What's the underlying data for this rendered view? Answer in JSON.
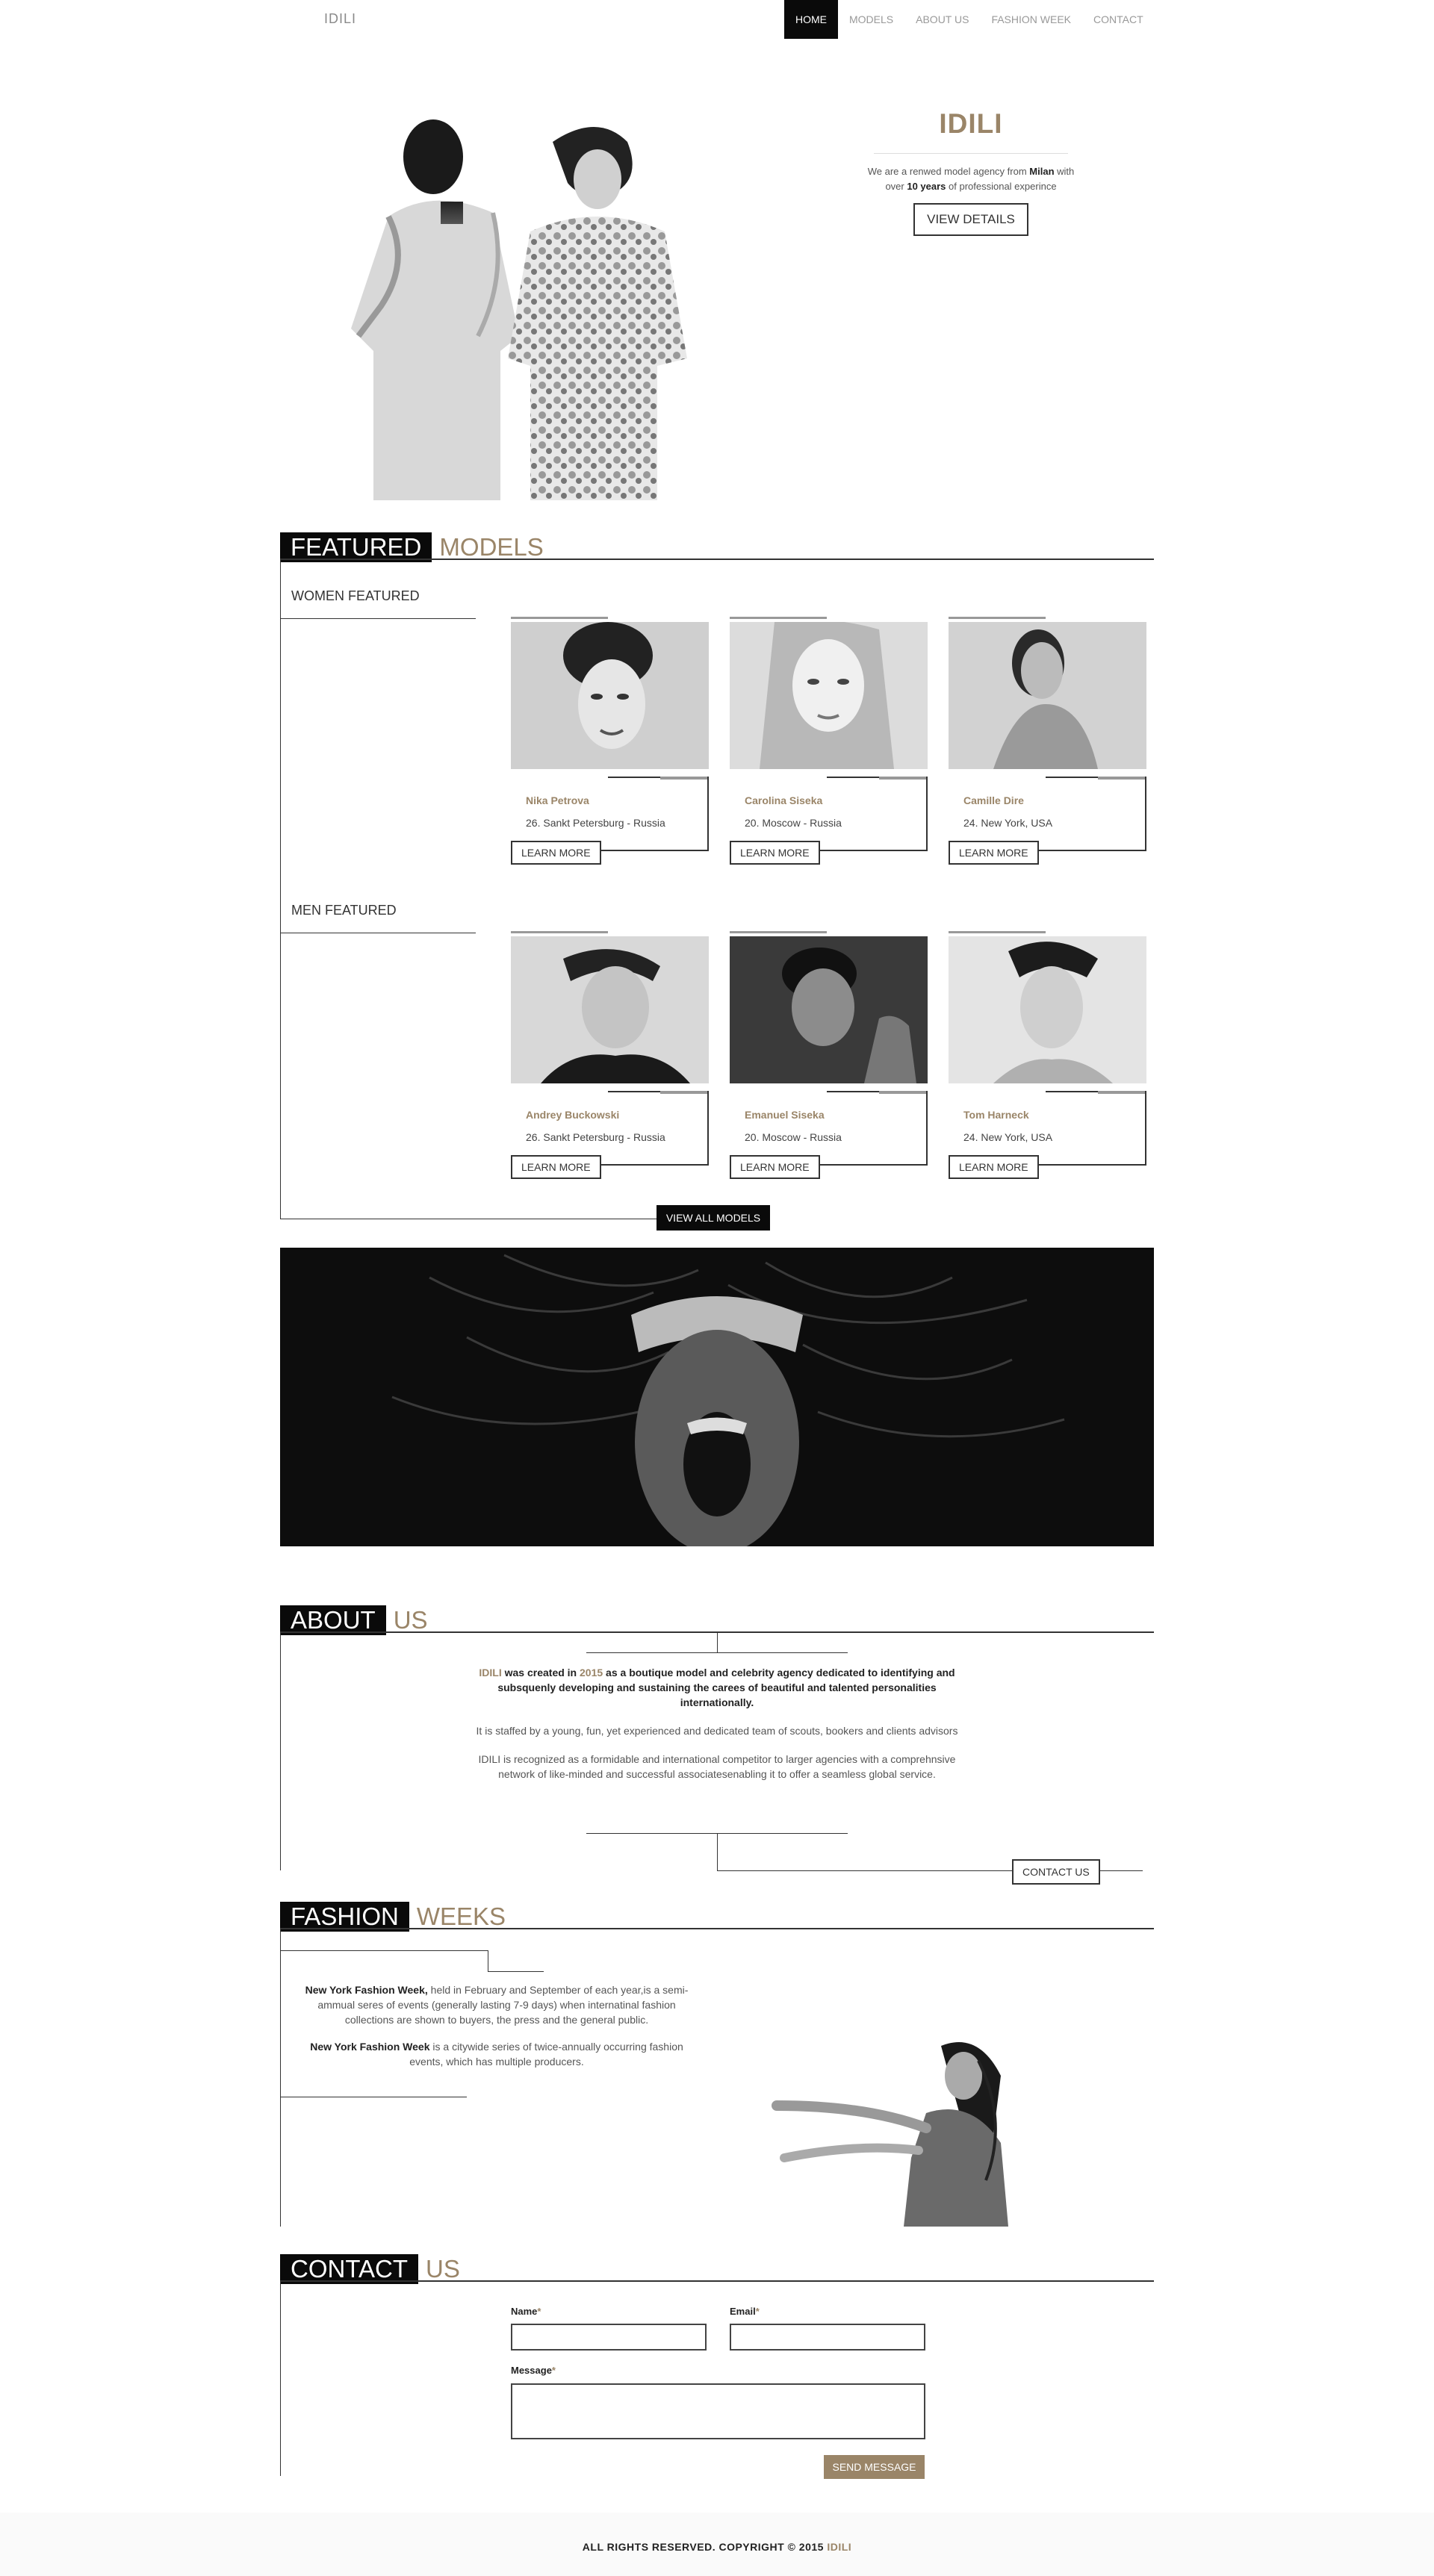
{
  "nav": {
    "brand": "IDILI",
    "items": [
      {
        "label": "HOME",
        "active": true
      },
      {
        "label": "MODELS",
        "active": false
      },
      {
        "label": "ABOUT US",
        "active": false
      },
      {
        "label": "FASHION WEEK",
        "active": false
      },
      {
        "label": "CONTACT",
        "active": false
      }
    ]
  },
  "hero": {
    "title": "IDILI",
    "desc_pre": "We are a renwed model agency from ",
    "desc_city": "Milan",
    "desc_mid": " with over ",
    "desc_years": "10 years",
    "desc_post": " of professional experince",
    "button": "VIEW DETAILS"
  },
  "featured": {
    "head_bold": "FEATURED",
    "head_light": "MODELS",
    "women_title": "WOMEN FEATURED",
    "men_title": "MEN FEATURED",
    "women": [
      {
        "name": "Nika Petrova",
        "location": "26. Sankt Petersburg - Russia",
        "button": "LEARN MORE"
      },
      {
        "name": "Carolina Siseka",
        "location": "20. Moscow - Russia",
        "button": "LEARN MORE"
      },
      {
        "name": "Camille Dire",
        "location": "24. New York, USA",
        "button": "LEARN MORE"
      }
    ],
    "men": [
      {
        "name": "Andrey Buckowski",
        "location": "26. Sankt Petersburg - Russia",
        "button": "LEARN MORE"
      },
      {
        "name": "Emanuel Siseka",
        "location": "20. Moscow - Russia",
        "button": "LEARN MORE"
      },
      {
        "name": "Tom Harneck",
        "location": "24. New York, USA",
        "button": "LEARN MORE"
      }
    ],
    "view_all": "VIEW ALL MODELS"
  },
  "about": {
    "head_bold": "ABOUT",
    "head_light": "US",
    "p1_brand": "IDILI",
    "p1_a": " was created in ",
    "p1_year": "2015",
    "p1_b": " as a boutique model and celebrity agency dedicated to identifying and subsquenly developing and sustaining the carees of beautiful and talented personalities internationally.",
    "p2": "It is staffed by a young, fun, yet experienced and dedicated team of scouts, bookers and clients advisors",
    "p3": "IDILI is recognized as a formidable and international competitor to larger agencies with a comprehnsive network of like-minded and successful associatesenabling it to offer a seamless global service.",
    "button": "CONTACT US"
  },
  "fashion": {
    "head_bold": "FASHION",
    "head_light": "WEEKS",
    "p1_bold": "New York Fashion Week,",
    "p1": " held in February and September of each year,is a semi-ammual seres of events (generally lasting 7-9 days) when internatinal fashion collections are shown to buyers, the press and the general public.",
    "p2_bold": "New York Fashion Week",
    "p2": " is a citywide series of twice-annually occurring fashion events, which has multiple producers."
  },
  "contact": {
    "head_bold": "CONTACT",
    "head_light": "US",
    "name_label": "Name",
    "email_label": "Email",
    "message_label": "Message",
    "required_mark": "*",
    "button": "SEND MESSAGE"
  },
  "footer": {
    "text": "ALL RIGHTS RESERVED. COPYRIGHT © 2015 ",
    "brand": "IDILI"
  },
  "colors": {
    "accent": "#9a8568",
    "dark": "#0a0a0a"
  }
}
